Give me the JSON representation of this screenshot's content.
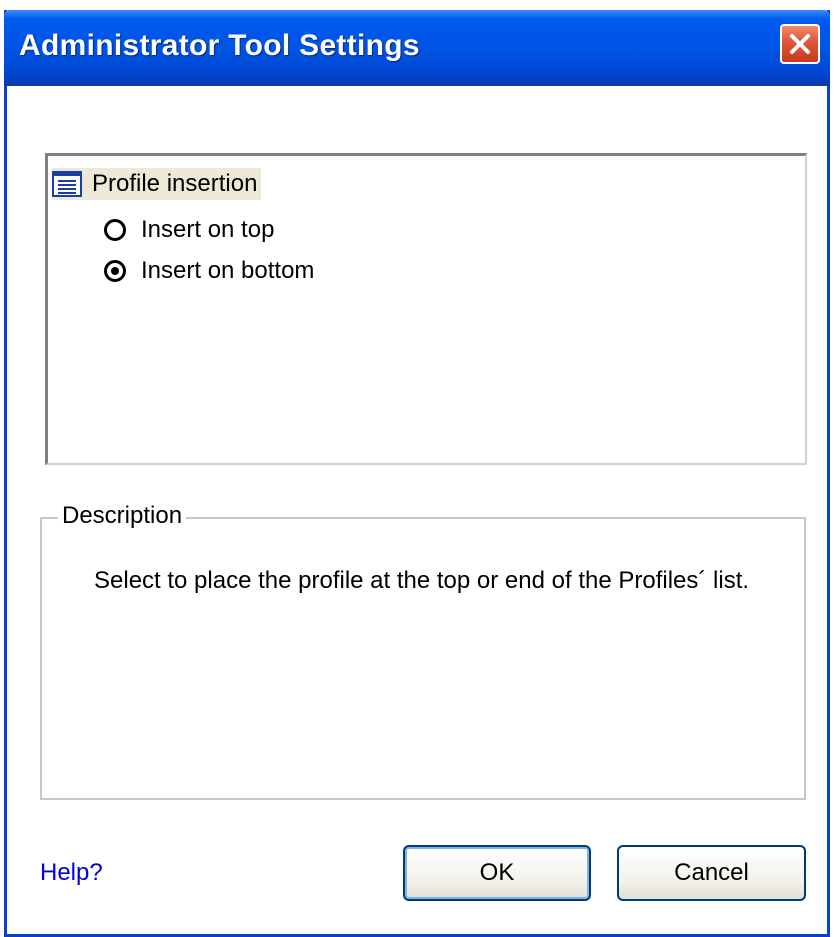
{
  "window": {
    "title": "Administrator Tool Settings",
    "close_icon": "close-icon"
  },
  "options": {
    "group": {
      "icon": "list-icon",
      "label": "Profile insertion"
    },
    "radios": [
      {
        "label": "Insert on top",
        "checked": false
      },
      {
        "label": "Insert on bottom",
        "checked": true
      }
    ]
  },
  "description": {
    "legend": "Description",
    "text": "Select to place the profile at the top or end of the Profiles´ list."
  },
  "footer": {
    "help_label": "Help?",
    "ok_label": "OK",
    "cancel_label": "Cancel"
  },
  "colors": {
    "titlebar": "#0055e5",
    "close_button": "#e0543a",
    "help_link": "#0000dd",
    "group_highlight": "#ece9d8"
  }
}
